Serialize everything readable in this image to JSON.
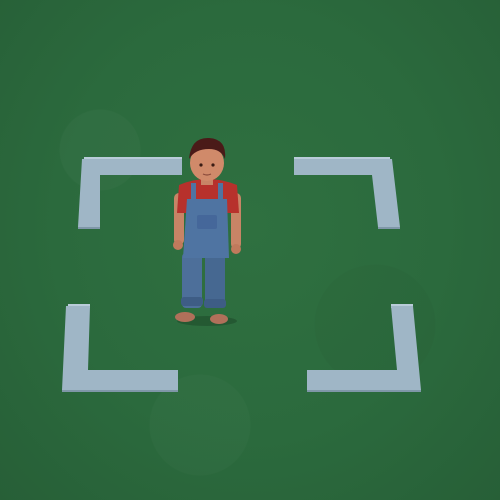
{
  "scene": {
    "ground_color": "#2b6a3d",
    "bracket_color": "#9fb6c6"
  },
  "character": {
    "hair_color": "#4a1a18",
    "shirt_color": "#b8322c",
    "overalls_color": "#4a6f9c",
    "skin_color": "#d08a6a"
  }
}
